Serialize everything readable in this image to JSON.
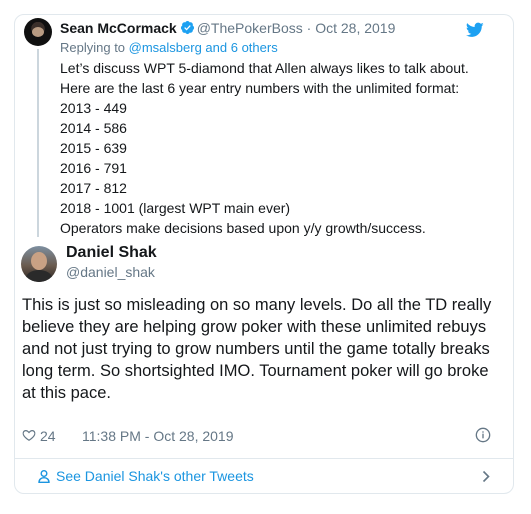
{
  "quoted": {
    "name": "Sean McCormack",
    "handle": "@ThePokerBoss",
    "separator": " · ",
    "date": "Oct 28, 2019",
    "replying_prefix": "Replying to ",
    "replying_link": "@msalsberg and 6 others",
    "body_lines": [
      "Let’s discuss WPT 5-diamond that Allen always likes to talk about.",
      "Here are the last 6 year entry numbers with the unlimited format:",
      "2013 - 449",
      "2014 - 586",
      "2015 - 639",
      "2016 - 791",
      "2017 - 812",
      "2018 - 1001 (largest WPT main ever)",
      "Operators make decisions based upon y/y growth/success."
    ]
  },
  "tweet": {
    "name": "Daniel Shak",
    "handle": "@daniel_shak",
    "text_lines": [
      "This is just so misleading on so many levels. Do all the TD really",
      "believe they are helping grow poker with these unlimited rebuys",
      "and not just trying to grow numbers until the game totally breaks",
      "long term. So shortsighted IMO. Tournament poker will go broke",
      "at this pace."
    ],
    "likes": "24",
    "timestamp": "11:38 PM - Oct 28, 2019"
  },
  "footer": {
    "link_text": "See Daniel Shak's other Tweets"
  },
  "colors": {
    "link": "#1b95e0",
    "muted": "#657786",
    "text": "#14171a",
    "border": "#e1e8ed"
  },
  "icons": [
    "verified-icon",
    "twitter-bird-icon",
    "heart-icon",
    "info-icon",
    "person-icon",
    "chevron-right-icon"
  ]
}
